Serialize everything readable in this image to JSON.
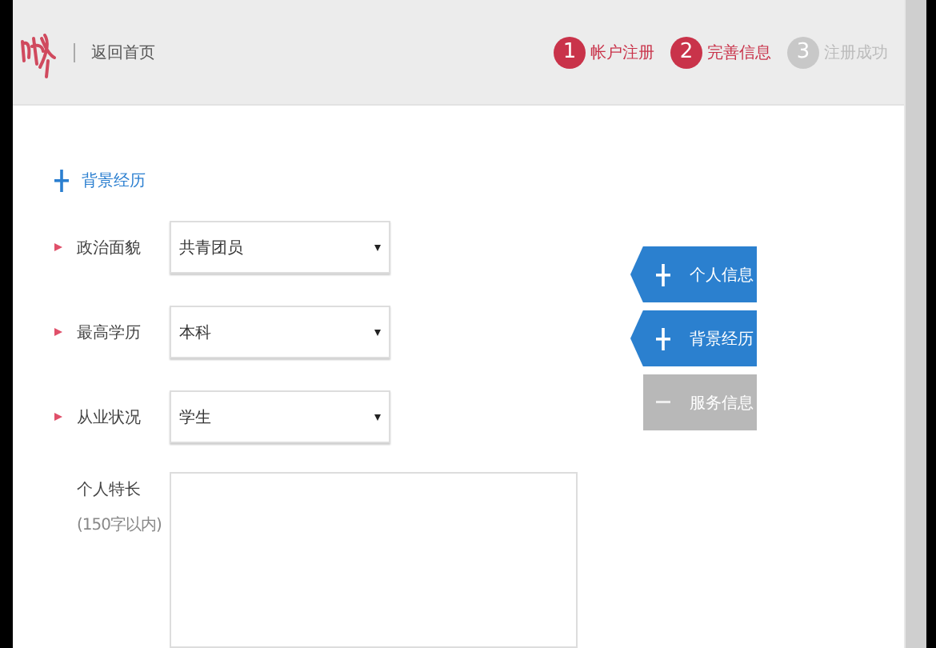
{
  "header": {
    "back_link": "返回首页",
    "steps": [
      {
        "number": "1",
        "label": "帐户注册",
        "active": true
      },
      {
        "number": "2",
        "label": "完善信息",
        "active": true
      },
      {
        "number": "3",
        "label": "注册成功",
        "active": false
      }
    ]
  },
  "section": {
    "title": "背景经历"
  },
  "fields": [
    {
      "label": "政治面貌",
      "required": true,
      "value": "共青团员"
    },
    {
      "label": "最高学历",
      "required": true,
      "value": "本科"
    },
    {
      "label": "从业状况",
      "required": true,
      "value": "学生"
    }
  ],
  "specialty": {
    "label": "个人特长",
    "hint": "(150字以内)"
  },
  "side_nav": [
    {
      "label": "个人信息",
      "disabled": false
    },
    {
      "label": "背景经历",
      "disabled": false
    },
    {
      "label": "服务信息",
      "disabled": true
    }
  ]
}
